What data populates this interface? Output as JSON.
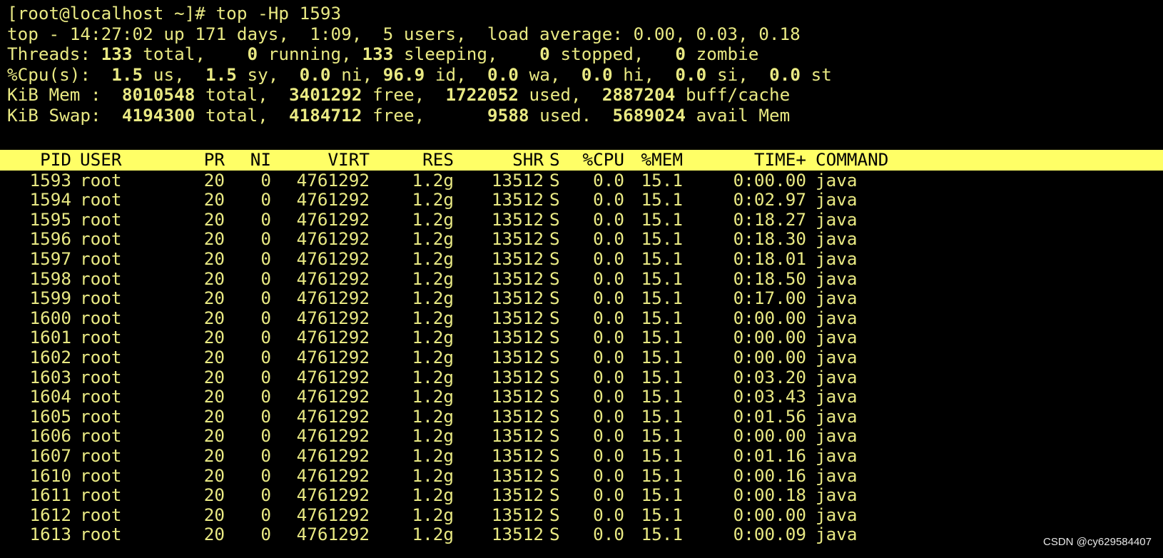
{
  "terminal": {
    "command_line": "[root@localhost ~]# top -Hp 1593",
    "summary": {
      "uptime_line": "top - 14:27:02 up 171 days,  1:09,  5 users,  load average: 0.00, 0.03, 0.18",
      "threads": {
        "label": "Threads:",
        "total": "133",
        "total_label": "total,",
        "running": "0",
        "running_label": "running,",
        "sleeping": "133",
        "sleeping_label": "sleeping,",
        "stopped": "0",
        "stopped_label": "stopped,",
        "zombie": "0",
        "zombie_label": "zombie"
      },
      "cpu": {
        "label": "%Cpu(s):",
        "us": "1.5",
        "us_label": "us,",
        "sy": "1.5",
        "sy_label": "sy,",
        "ni": "0.0",
        "ni_label": "ni,",
        "id": "96.9",
        "id_label": "id,",
        "wa": "0.0",
        "wa_label": "wa,",
        "hi": "0.0",
        "hi_label": "hi,",
        "si": "0.0",
        "si_label": "si,",
        "st": "0.0",
        "st_label": "st"
      },
      "mem": {
        "label": "KiB Mem :",
        "total": "8010548",
        "total_label": "total,",
        "free": "3401292",
        "free_label": "free,",
        "used": "1722052",
        "used_label": "used,",
        "buff": "2887204",
        "buff_label": "buff/cache"
      },
      "swap": {
        "label": "KiB Swap:",
        "total": "4194300",
        "total_label": "total,",
        "free": "4184712",
        "free_label": "free,",
        "used": "9588",
        "used_label": "used.",
        "avail": "5689024",
        "avail_label": "avail Mem"
      }
    },
    "columns": [
      "PID",
      "USER",
      "PR",
      "NI",
      "VIRT",
      "RES",
      "SHR",
      "S",
      "%CPU",
      "%MEM",
      "TIME+",
      "COMMAND"
    ],
    "rows": [
      [
        "1593",
        "root",
        "20",
        "0",
        "4761292",
        "1.2g",
        "13512",
        "S",
        "0.0",
        "15.1",
        "0:00.00",
        "java"
      ],
      [
        "1594",
        "root",
        "20",
        "0",
        "4761292",
        "1.2g",
        "13512",
        "S",
        "0.0",
        "15.1",
        "0:02.97",
        "java"
      ],
      [
        "1595",
        "root",
        "20",
        "0",
        "4761292",
        "1.2g",
        "13512",
        "S",
        "0.0",
        "15.1",
        "0:18.27",
        "java"
      ],
      [
        "1596",
        "root",
        "20",
        "0",
        "4761292",
        "1.2g",
        "13512",
        "S",
        "0.0",
        "15.1",
        "0:18.30",
        "java"
      ],
      [
        "1597",
        "root",
        "20",
        "0",
        "4761292",
        "1.2g",
        "13512",
        "S",
        "0.0",
        "15.1",
        "0:18.01",
        "java"
      ],
      [
        "1598",
        "root",
        "20",
        "0",
        "4761292",
        "1.2g",
        "13512",
        "S",
        "0.0",
        "15.1",
        "0:18.50",
        "java"
      ],
      [
        "1599",
        "root",
        "20",
        "0",
        "4761292",
        "1.2g",
        "13512",
        "S",
        "0.0",
        "15.1",
        "0:17.00",
        "java"
      ],
      [
        "1600",
        "root",
        "20",
        "0",
        "4761292",
        "1.2g",
        "13512",
        "S",
        "0.0",
        "15.1",
        "0:00.00",
        "java"
      ],
      [
        "1601",
        "root",
        "20",
        "0",
        "4761292",
        "1.2g",
        "13512",
        "S",
        "0.0",
        "15.1",
        "0:00.00",
        "java"
      ],
      [
        "1602",
        "root",
        "20",
        "0",
        "4761292",
        "1.2g",
        "13512",
        "S",
        "0.0",
        "15.1",
        "0:00.00",
        "java"
      ],
      [
        "1603",
        "root",
        "20",
        "0",
        "4761292",
        "1.2g",
        "13512",
        "S",
        "0.0",
        "15.1",
        "0:03.20",
        "java"
      ],
      [
        "1604",
        "root",
        "20",
        "0",
        "4761292",
        "1.2g",
        "13512",
        "S",
        "0.0",
        "15.1",
        "0:03.43",
        "java"
      ],
      [
        "1605",
        "root",
        "20",
        "0",
        "4761292",
        "1.2g",
        "13512",
        "S",
        "0.0",
        "15.1",
        "0:01.56",
        "java"
      ],
      [
        "1606",
        "root",
        "20",
        "0",
        "4761292",
        "1.2g",
        "13512",
        "S",
        "0.0",
        "15.1",
        "0:00.00",
        "java"
      ],
      [
        "1607",
        "root",
        "20",
        "0",
        "4761292",
        "1.2g",
        "13512",
        "S",
        "0.0",
        "15.1",
        "0:01.16",
        "java"
      ],
      [
        "1610",
        "root",
        "20",
        "0",
        "4761292",
        "1.2g",
        "13512",
        "S",
        "0.0",
        "15.1",
        "0:00.16",
        "java"
      ],
      [
        "1611",
        "root",
        "20",
        "0",
        "4761292",
        "1.2g",
        "13512",
        "S",
        "0.0",
        "15.1",
        "0:00.18",
        "java"
      ],
      [
        "1612",
        "root",
        "20",
        "0",
        "4761292",
        "1.2g",
        "13512",
        "S",
        "0.0",
        "15.1",
        "0:00.00",
        "java"
      ],
      [
        "1613",
        "root",
        "20",
        "0",
        "4761292",
        "1.2g",
        "13512",
        "S",
        "0.0",
        "15.1",
        "0:00.09",
        "java"
      ]
    ]
  },
  "watermark": "CSDN @cy629584407",
  "colors": {
    "background": "#000000",
    "foreground": "#e9e983",
    "header_bar": "#ffff66",
    "header_text": "#000000"
  }
}
